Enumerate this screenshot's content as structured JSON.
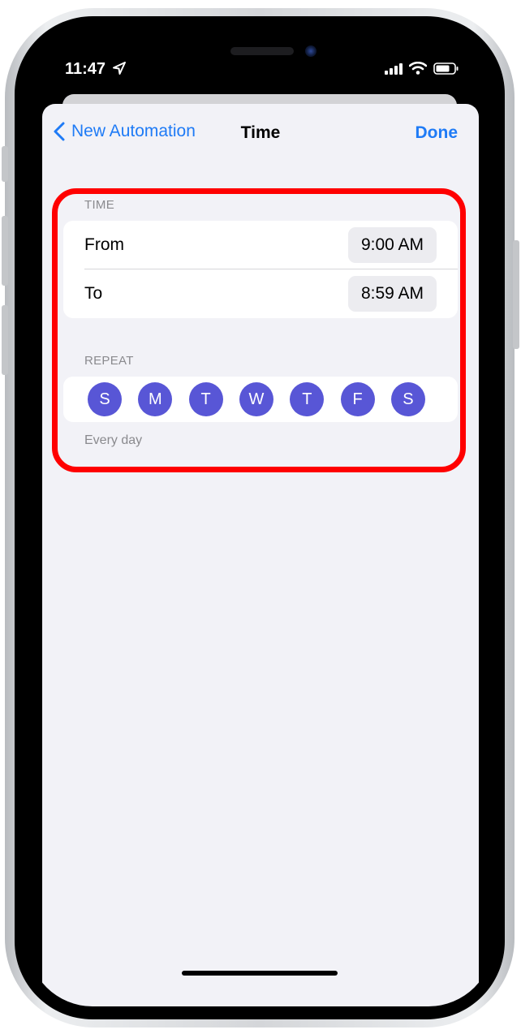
{
  "status_bar": {
    "time": "11:47"
  },
  "nav": {
    "back_label": "New Automation",
    "title": "Time",
    "done_label": "Done"
  },
  "time_section": {
    "header": "TIME",
    "from_label": "From",
    "from_value": "9:00 AM",
    "to_label": "To",
    "to_value": "8:59 AM"
  },
  "repeat_section": {
    "header": "REPEAT",
    "days": [
      "S",
      "M",
      "T",
      "W",
      "T",
      "F",
      "S"
    ],
    "summary": "Every day"
  },
  "colors": {
    "accent": "#1f7bf6",
    "day_selected": "#5856d6",
    "highlight": "#ff0000",
    "background": "#f2f2f7"
  }
}
